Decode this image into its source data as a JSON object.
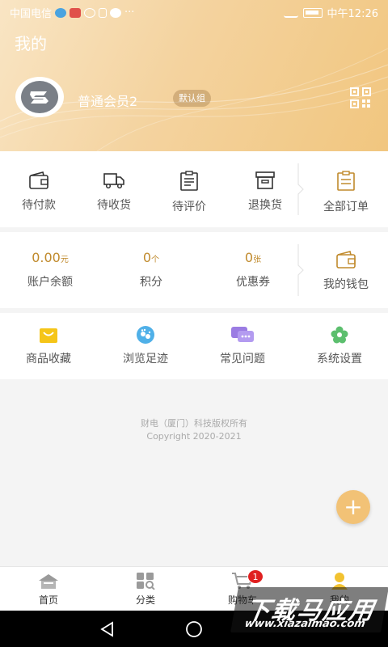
{
  "status_bar": {
    "carrier": "中国电信",
    "time": "中午12:26",
    "more": "···"
  },
  "header": {
    "title": "我的",
    "user_name": "普通会员2",
    "group_badge": "默认组"
  },
  "orders": [
    {
      "label": "待付款",
      "icon": "wallet-icon"
    },
    {
      "label": "待收货",
      "icon": "truck-icon"
    },
    {
      "label": "待评价",
      "icon": "clipboard-icon"
    },
    {
      "label": "退换货",
      "icon": "box-icon"
    },
    {
      "label": "全部订单",
      "icon": "order-list-icon"
    }
  ],
  "wallet": {
    "balance": {
      "value": "0.00",
      "unit": "元",
      "label": "账户余额"
    },
    "points": {
      "value": "0",
      "unit": "个",
      "label": "积分"
    },
    "coupons": {
      "value": "0",
      "unit": "张",
      "label": "优惠券"
    },
    "my_wallet": {
      "label": "我的钱包"
    }
  },
  "tools": [
    {
      "label": "商品收藏",
      "icon": "favorites-icon"
    },
    {
      "label": "浏览足迹",
      "icon": "footprint-icon"
    },
    {
      "label": "常见问题",
      "icon": "chat-icon"
    },
    {
      "label": "系统设置",
      "icon": "settings-flower-icon"
    }
  ],
  "copyright": {
    "line1": "财电（厦门）科技版权所有",
    "line2": "Copyright 2020-2021"
  },
  "fab": {
    "symbol": "+"
  },
  "tabs": [
    {
      "label": "首页",
      "icon": "home-icon"
    },
    {
      "label": "分类",
      "icon": "category-icon"
    },
    {
      "label": "购物车",
      "icon": "cart-icon",
      "badge": "1"
    },
    {
      "label": "我的",
      "icon": "user-icon"
    }
  ],
  "watermark": {
    "title": "下载马应用",
    "url": "www.xiazaimao.com"
  },
  "colors": {
    "accent": "#c08a2c",
    "header": "#f4d39f",
    "badge": "#e02020"
  }
}
